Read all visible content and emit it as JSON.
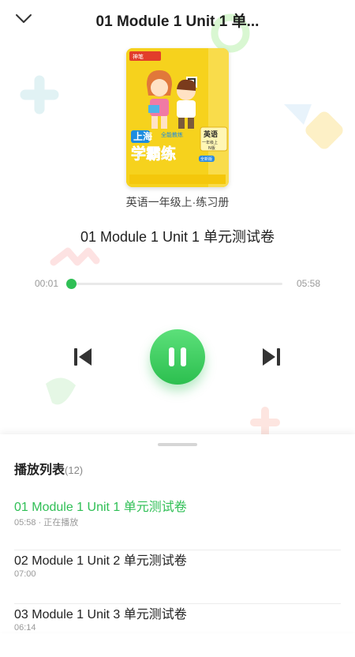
{
  "header": {
    "title": "01 Module 1 Unit 1 单...",
    "back_icon": "chevron-down-icon"
  },
  "cover": {
    "publisher": "神笔",
    "series": "全能教练",
    "brand": "上海 学霸练",
    "subject_badge": "英语",
    "grade_badge": "一年级上",
    "edition_badge": "N版",
    "tag": "全新版"
  },
  "book": {
    "subtitle": "英语一年级上·练习册"
  },
  "track": {
    "title": "01 Module 1 Unit 1 单元测试卷"
  },
  "player": {
    "current_time": "00:01",
    "total_time": "05:58",
    "progress": 0.003,
    "state": "playing",
    "accent": "#2fbf55"
  },
  "playlist": {
    "heading": "播放列表",
    "count": "(12)",
    "items": [
      {
        "title": "01 Module 1 Unit 1 单元测试卷",
        "meta": "05:58 · 正在播放",
        "active": true
      },
      {
        "title": "02 Module 1 Unit 2  单元测试卷",
        "meta": "07:00",
        "active": false
      },
      {
        "title": "03 Module 1 Unit 3  单元测试卷",
        "meta": "06:14",
        "active": false
      }
    ]
  }
}
